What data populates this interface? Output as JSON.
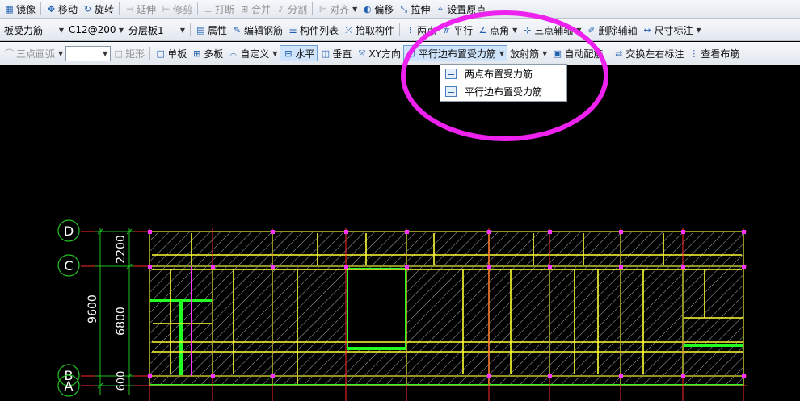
{
  "toolbar1": {
    "mirror": "镜像",
    "move": "移动",
    "rotate": "旋转",
    "extend": "延伸",
    "trim": "修剪",
    "break": "打断",
    "merge": "合并",
    "split": "分割",
    "align": "对齐",
    "offset": "偏移",
    "stretch": "拉伸",
    "origin": "设置原点"
  },
  "toolbar2": {
    "type_select": "板受力筋",
    "spec_select": "C12@200",
    "layer_select": "分层板1",
    "property": "属性",
    "edit_rebar": "编辑钢筋",
    "component_list": "构件列表",
    "pick_component": "拾取构件",
    "two_points": "两点",
    "parallel": "平行",
    "point_angle": "点角",
    "three_point_axis": "三点辅轴",
    "delete_axis": "删除辅轴",
    "dimension": "尺寸标注"
  },
  "toolbar3": {
    "arc": "三点画弧",
    "rect": "矩形",
    "single_slab": "单板",
    "multi_slab": "多板",
    "custom": "自定义",
    "horizontal": "水平",
    "vertical": "垂直",
    "xy_direction": "XY方向",
    "parallel_edge_rebar": "平行边布置受力筋",
    "radial_rebar": "放射筋",
    "auto_rebar": "自动配筋",
    "swap_labels": "交换左右标注",
    "view_layout": "查看布筋"
  },
  "dropdown": {
    "items": [
      "两点布置受力筋",
      "平行边布置受力筋"
    ]
  },
  "drawing": {
    "axis_labels": [
      "D",
      "C",
      "B",
      "A"
    ],
    "dimensions": {
      "total": "9600",
      "d_c": "2200",
      "c_b": "6800",
      "b_a": "600"
    }
  },
  "colors": {
    "slab_fill": "#000000",
    "slab_edge": "#22ff22",
    "rebar": "#ffff33",
    "grid": "#ff2a2a",
    "hatch": "#d8d8d8",
    "dimension": "#22c022",
    "axis_bubble": "#ffffff",
    "node": "#ff33ff",
    "annotation": "#ee22ee"
  }
}
